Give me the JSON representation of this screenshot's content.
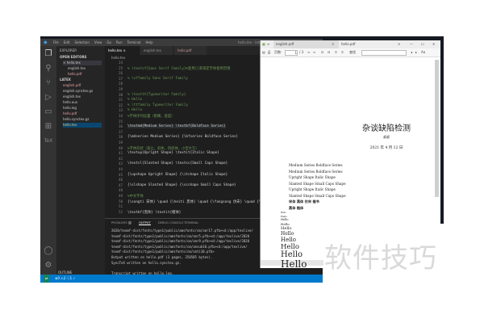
{
  "vscode": {
    "title": "hello.tex - latex - Visual Studio Code",
    "menu": [
      "File",
      "Edit",
      "Selection",
      "View",
      "Go",
      "Run",
      "Terminal",
      "Help"
    ],
    "sidebar": {
      "header": "EXPLORER",
      "open_editors": "OPEN EDITORS",
      "open_files": [
        "hello.tex",
        "english.tex",
        "hello.pdf"
      ],
      "folder": "LATEX",
      "files": [
        "english.pdf",
        "english.synctex.gz",
        "english.tex",
        "hello.aux",
        "hello.log",
        "hello.pdf",
        "hello.synctex.gz",
        "hello.tex"
      ],
      "outline": "OUTLINE"
    },
    "tabs": [
      "hello.tex",
      "english.tex",
      "hello.pdf"
    ],
    "breadcrumb": "hello.tex",
    "code": [
      {
        "n": "24",
        "t": "",
        "k": ""
      },
      {
        "n": "25",
        "t": "% \\textsf{Sans Serif Family}%使用{}来限定字体使用范围",
        "k": "c"
      },
      {
        "n": "26",
        "t": "",
        "k": ""
      },
      {
        "n": "27",
        "t": "% \\sffamily Sans Serif Family",
        "k": "c"
      },
      {
        "n": "28",
        "t": "",
        "k": ""
      },
      {
        "n": "29",
        "t": "",
        "k": ""
      },
      {
        "n": "30",
        "t": "% \\texttt{Typewriter Family}",
        "k": "c"
      },
      {
        "n": "31",
        "t": "% Hello",
        "k": "c"
      },
      {
        "n": "32",
        "t": "% \\ttfamily Typewriter Family",
        "k": "c"
      },
      {
        "n": "33",
        "t": "% Hello",
        "k": "c"
      },
      {
        "n": "34",
        "t": "%字体序列设置（粗细，宽度）",
        "k": "c"
      },
      {
        "n": "35",
        "t": "",
        "k": ""
      },
      {
        "n": "36",
        "t": "\\textmd{Medium Series} \\textbf{Boldface Series}",
        "k": "cur"
      },
      {
        "n": "37",
        "t": "",
        "k": ""
      },
      {
        "n": "38",
        "t": "{\\mdseries Medium Series} {\\bfseries Boldface Series}",
        "k": ""
      },
      {
        "n": "39",
        "t": "",
        "k": ""
      },
      {
        "n": "40",
        "t": "%字体形状（直立，斜体，伪斜体，小型大写）",
        "k": "c"
      },
      {
        "n": "41",
        "t": "\\textup{Upright Shape} \\textit{Italic Shape}",
        "k": ""
      },
      {
        "n": "42",
        "t": "",
        "k": ""
      },
      {
        "n": "43",
        "t": "\\textsl{Slanted Shape} \\textsc{Small Caps Shape}",
        "k": ""
      },
      {
        "n": "44",
        "t": "",
        "k": ""
      },
      {
        "n": "45",
        "t": "{\\upshape Upright Shape} {\\itshape Italic Shape}",
        "k": ""
      },
      {
        "n": "46",
        "t": "",
        "k": ""
      },
      {
        "n": "47",
        "t": "{\\slshape Slanted Shape} {\\scshape Small Caps Shape}",
        "k": ""
      },
      {
        "n": "48",
        "t": "",
        "k": ""
      },
      {
        "n": "49",
        "t": "%中文字体",
        "k": "c"
      },
      {
        "n": "50",
        "t": "{\\songti 宋体} \\quad {\\heiti 黑体} \\quad {\\fangsong 仿宋} \\quad {\\kaishu 楷书}",
        "k": ""
      },
      {
        "n": "51",
        "t": "",
        "k": ""
      },
      {
        "n": "52",
        "t": "\\textbf{黑体} \\textit{楷体}",
        "k": ""
      }
    ],
    "panel": {
      "tabs": [
        "PROBLEMS",
        "OUTPUT",
        "DEBUG CONSOLE",
        "TERMINAL"
      ],
      "problems_count": "5",
      "output": [
        "2020/texmf-dist/fonts/type1/public/amsfonts/cm/cmr17.pfb><d:/app/texlive/",
        "texmf-dist/fonts/type1/public/amsfonts/cm/cmr5.pfb><d:/app/texlive/2020",
        "texmf-dist/fonts/type1/public/amsfonts/cm/cmr9.pfb><d:/app/texlive/2020",
        "texmf-dist/fonts/type1/public/amsfonts/cm/cmsub10.pfb><d:/app/texlive/",
        "texmf-dist/fonts/type1/public/amsfonts/cm/cmti10.pfb>",
        "Output written on hello.pdf (3 pages, 250505 bytes).",
        "SyncTeX written on hello.synctex.gz.",
        "",
        "Transcript written on hello.log."
      ]
    },
    "status": {
      "errors": "0",
      "warnings": "2",
      "info": "1",
      "check": "✓"
    }
  },
  "pdf_viewer": {
    "tabs": [
      "english.pdf",
      "hello.pdf"
    ],
    "page_label": "页数:",
    "page": "1",
    "total_pages": "/ 3",
    "search_label": "查找",
    "doc": {
      "title": "杂谈缺陷检测",
      "author": "叔叔",
      "date": "2021 年 4 月 12 日",
      "lines": [
        "Medium Series Boldface Series",
        "Medium Series Boldface Series",
        "Upright Shape Italic Shape",
        "Slanted Shape Small Caps Shape",
        "Upright Shape Italic Shape",
        "Slanted Shape Small Caps Shape",
        "宋体  黑体  仿宋  楷书",
        "黑体 楷体"
      ],
      "hello": [
        "Hello",
        "Hello",
        "Hello",
        "Hello",
        "Hello",
        "Hello",
        "Hello",
        "Hello",
        "Hello",
        "Hello"
      ]
    }
  },
  "watermark": "软件技巧"
}
